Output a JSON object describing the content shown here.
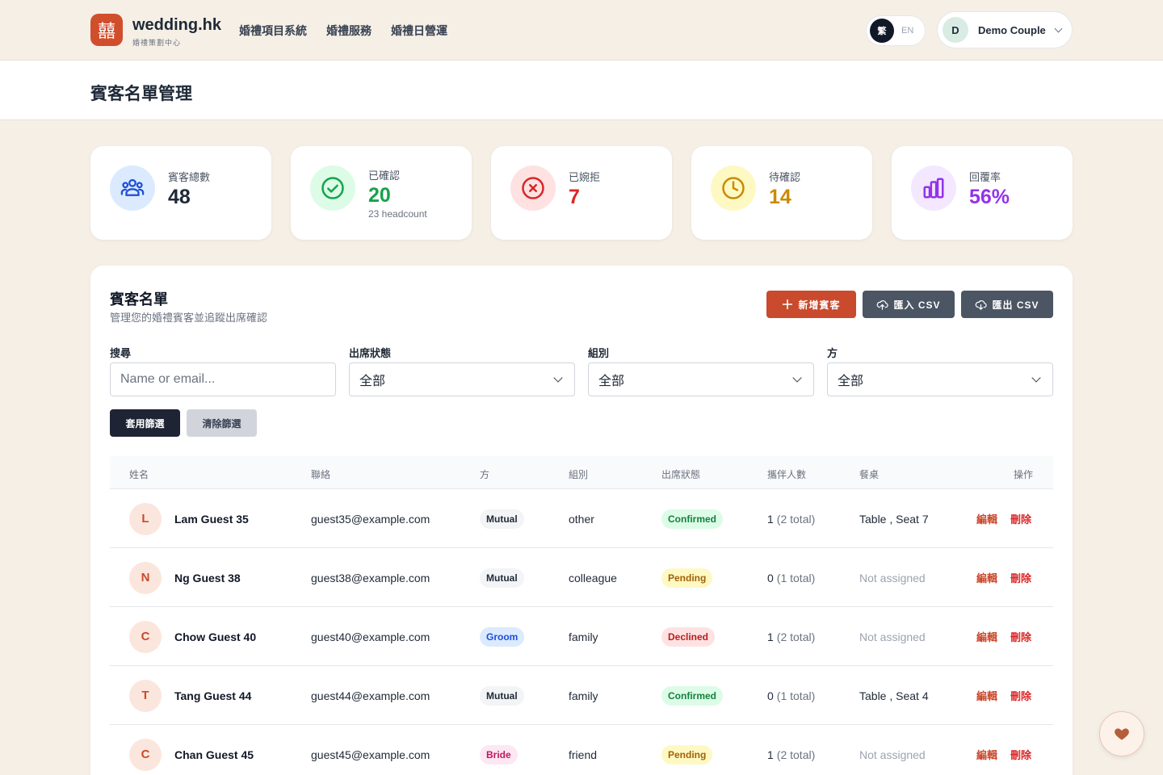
{
  "header": {
    "logo_glyph": "囍",
    "brand_name": "wedding.hk",
    "brand_sub": "婚禮策劃中心",
    "nav": [
      "婚禮項目系統",
      "婚禮服務",
      "婚禮日營運"
    ],
    "lang_active": "繁",
    "lang_other": "EN",
    "user_initial": "D",
    "user_name": "Demo Couple"
  },
  "page_title": "賓客名單管理",
  "stats": [
    {
      "label": "賓客總數",
      "value": "48",
      "sub": "",
      "icon": "users-icon",
      "color": "#1f2937"
    },
    {
      "label": "已確認",
      "value": "20",
      "sub": "23 headcount",
      "icon": "check-circle-icon",
      "color": "#16a34a"
    },
    {
      "label": "已婉拒",
      "value": "7",
      "sub": "",
      "icon": "x-circle-icon",
      "color": "#dc2626"
    },
    {
      "label": "待確認",
      "value": "14",
      "sub": "",
      "icon": "clock-icon",
      "color": "#ca8a04"
    },
    {
      "label": "回覆率",
      "value": "56%",
      "sub": "",
      "icon": "bar-chart-icon",
      "color": "#9333ea"
    }
  ],
  "panel": {
    "title": "賓客名單",
    "subtitle": "管理您的婚禮賓客並追蹤出席確認",
    "add_label": "新增賓客",
    "import_label": "匯入 CSV",
    "export_label": "匯出 CSV"
  },
  "filters": {
    "search_label": "搜尋",
    "search_placeholder": "Name or email...",
    "status_label": "出席狀態",
    "status_value": "全部",
    "group_label": "組別",
    "group_value": "全部",
    "side_label": "方",
    "side_value": "全部",
    "apply_label": "套用篩選",
    "clear_label": "清除篩選"
  },
  "table": {
    "headers": [
      "姓名",
      "聯絡",
      "方",
      "組別",
      "出席狀態",
      "攜伴人數",
      "餐桌",
      "操作"
    ],
    "edit_label": "編輯",
    "delete_label": "刪除",
    "rows": [
      {
        "initial": "L",
        "name": "Lam Guest 35",
        "email": "guest35@example.com",
        "side": "Mutual",
        "side_class": "side-mutual",
        "group": "other",
        "status": "Confirmed",
        "status_class": "st-confirmed",
        "plus": "1",
        "total": "(2 total)",
        "table": "Table , Seat 7",
        "assigned": true
      },
      {
        "initial": "N",
        "name": "Ng Guest 38",
        "email": "guest38@example.com",
        "side": "Mutual",
        "side_class": "side-mutual",
        "group": "colleague",
        "status": "Pending",
        "status_class": "st-pending",
        "plus": "0",
        "total": "(1 total)",
        "table": "Not assigned",
        "assigned": false
      },
      {
        "initial": "C",
        "name": "Chow Guest 40",
        "email": "guest40@example.com",
        "side": "Groom",
        "side_class": "side-groom",
        "group": "family",
        "status": "Declined",
        "status_class": "st-declined",
        "plus": "1",
        "total": "(2 total)",
        "table": "Not assigned",
        "assigned": false
      },
      {
        "initial": "T",
        "name": "Tang Guest 44",
        "email": "guest44@example.com",
        "side": "Mutual",
        "side_class": "side-mutual",
        "group": "family",
        "status": "Confirmed",
        "status_class": "st-confirmed",
        "plus": "0",
        "total": "(1 total)",
        "table": "Table , Seat 4",
        "assigned": true
      },
      {
        "initial": "C",
        "name": "Chan Guest 45",
        "email": "guest45@example.com",
        "side": "Bride",
        "side_class": "side-bride",
        "group": "friend",
        "status": "Pending",
        "status_class": "st-pending",
        "plus": "1",
        "total": "(2 total)",
        "table": "Not assigned",
        "assigned": false
      }
    ]
  },
  "fab_icon": "heart-icon"
}
